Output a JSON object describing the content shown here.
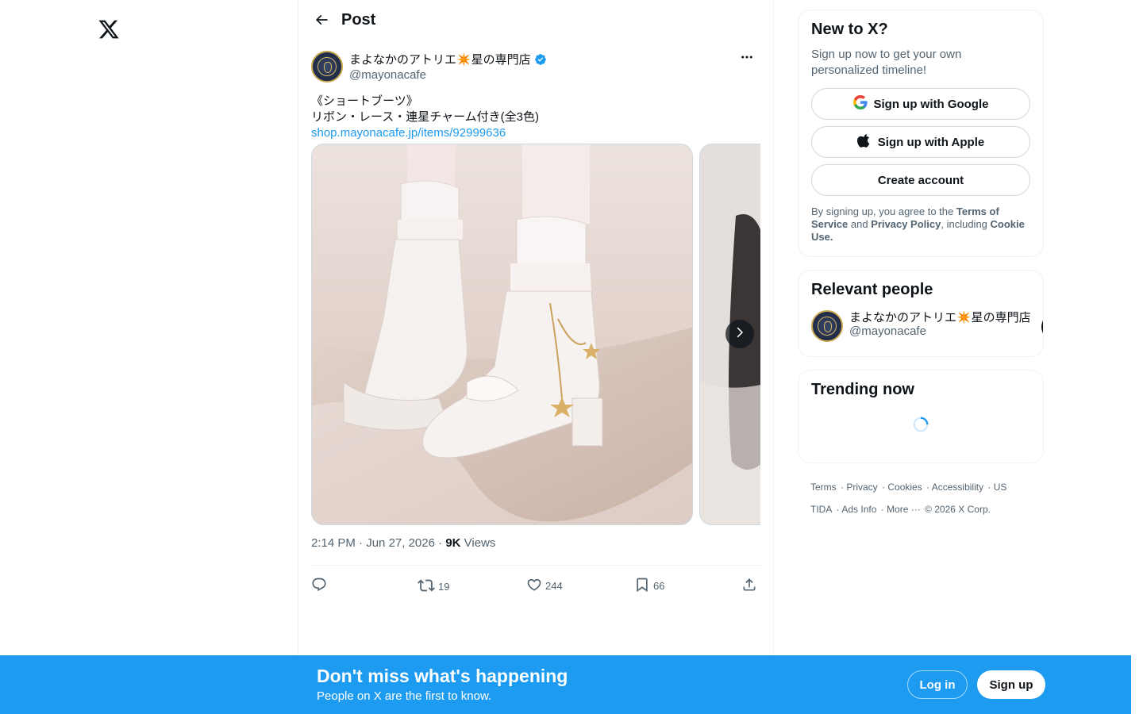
{
  "nav": {
    "logo_icon": "x-logo-icon"
  },
  "header": {
    "title": "Post",
    "back_icon": "arrow-left-icon"
  },
  "post": {
    "author_name": "まよなかのアトリエ✴️星の専門店",
    "author_handle": "@mayonacafe",
    "verified": true,
    "text_lines": [
      "《ショートブーツ》",
      "リボン・レース・連星チャーム付き(全3色)"
    ],
    "link": "shop.mayonacafe.jp/items/92999636",
    "time": "2:14 PM",
    "date": "Jun 27, 2026",
    "views_count": "9K",
    "views_label": "Views",
    "actions": {
      "reply_count": "",
      "repost_count": "19",
      "like_count": "244",
      "bookmark_count": "66"
    }
  },
  "signup_card": {
    "title": "New to X?",
    "subtitle": "Sign up now to get your own personalized timeline!",
    "google_label": "Sign up with Google",
    "apple_label": "Sign up with Apple",
    "create_label": "Create account",
    "legal_prefix": "By signing up, you agree to the ",
    "terms": "Terms of Service",
    "and": " and ",
    "privacy": "Privacy Policy",
    "including": ", including ",
    "cookie": "Cookie Use."
  },
  "relevant": {
    "title": "Relevant people",
    "name": "まよなかのアトリエ✴️星の専門店",
    "handle": "@mayonacafe"
  },
  "trending": {
    "title": "Trending now"
  },
  "footer": {
    "links": [
      "Terms",
      "Privacy",
      "Cookies",
      "Accessibility",
      "US TIDA",
      "Ads Info",
      "More ···"
    ],
    "copyright": "© 2026 X Corp."
  },
  "bottom_bar": {
    "title": "Don't miss what's happening",
    "subtitle": "People on X are the first to know.",
    "login": "Log in",
    "signup": "Sign up"
  },
  "colors": {
    "accent": "#1d9bf0",
    "text": "#0f1419",
    "muted": "#536471"
  }
}
